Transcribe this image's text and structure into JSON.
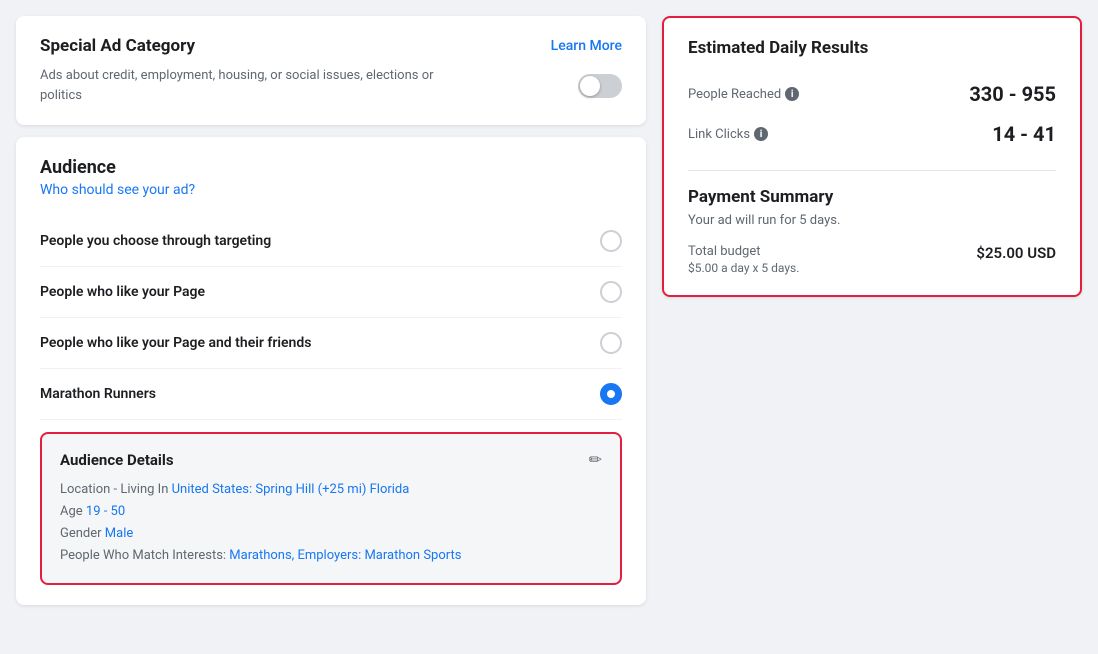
{
  "special_ad": {
    "title": "Special Ad Category",
    "learn_more_label": "Learn More",
    "description": "Ads about credit, employment, housing, or social issues, elections or politics",
    "toggle_enabled": false
  },
  "audience": {
    "title": "Audience",
    "subtitle": "Who should see your ad?",
    "options": [
      {
        "label": "People you choose through targeting",
        "selected": false
      },
      {
        "label": "People who like your Page",
        "selected": false
      },
      {
        "label": "People who like your Page and their friends",
        "selected": false
      },
      {
        "label": "Marathon Runners",
        "selected": true
      }
    ],
    "details": {
      "title": "Audience Details",
      "location_prefix": "Location - Living In ",
      "location_link": "United States: Spring Hill (+25 mi) Florida",
      "age_prefix": "Age ",
      "age_link": "19 - 50",
      "gender_prefix": "Gender ",
      "gender_link": "Male",
      "interests_prefix": "People Who Match Interests: ",
      "interests_link": "Marathons, Employers: Marathon Sports"
    }
  },
  "estimated": {
    "title": "Estimated Daily Results",
    "people_reached_label": "People Reached",
    "people_reached_value": "330 - 955",
    "link_clicks_label": "Link Clicks",
    "link_clicks_value": "14 - 41"
  },
  "payment": {
    "title": "Payment Summary",
    "subtitle": "Your ad will run for 5 days.",
    "total_budget_label": "Total budget",
    "total_budget_value": "$25.00 USD",
    "breakdown": "$5.00 a day x 5 days."
  }
}
